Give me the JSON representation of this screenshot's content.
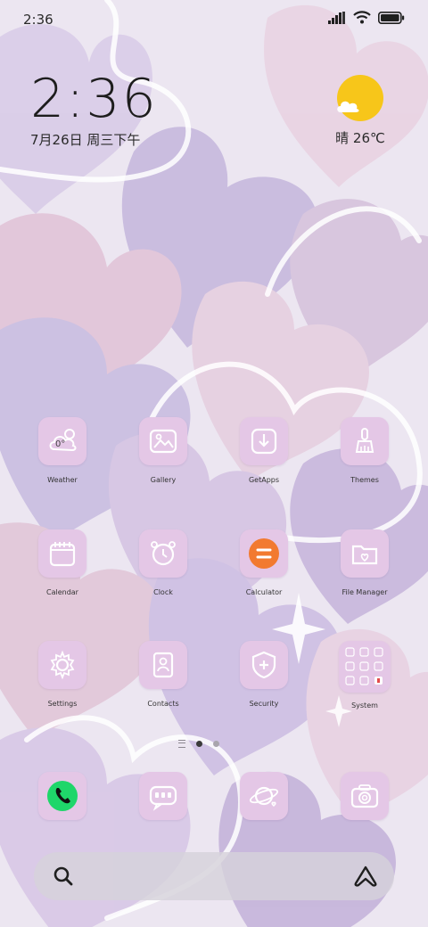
{
  "status_bar": {
    "time": "2:36",
    "icons": [
      "signal-icon",
      "wifi-icon",
      "battery-icon"
    ]
  },
  "clock_widget": {
    "time": "2:36",
    "date": "7月26日 周三下午"
  },
  "weather_widget": {
    "icon": "sun-cloud-icon",
    "text": "晴 26℃"
  },
  "apps": [
    {
      "label": "Weather",
      "icon": "weather-icon"
    },
    {
      "label": "Gallery",
      "icon": "gallery-icon"
    },
    {
      "label": "GetApps",
      "icon": "getapps-icon"
    },
    {
      "label": "Themes",
      "icon": "themes-icon"
    },
    {
      "label": "Calendar",
      "icon": "calendar-icon"
    },
    {
      "label": "Clock",
      "icon": "clock-icon"
    },
    {
      "label": "Calculator",
      "icon": "calculator-icon"
    },
    {
      "label": "File Manager",
      "icon": "file-manager-icon"
    },
    {
      "label": "Settings",
      "icon": "settings-icon"
    },
    {
      "label": "Contacts",
      "icon": "contacts-icon"
    },
    {
      "label": "Security",
      "icon": "security-icon"
    },
    {
      "label": "System",
      "icon": "system-folder-icon"
    }
  ],
  "weather_app_glyph": "0°",
  "pager": {
    "pages": 2,
    "active_page": 1
  },
  "dock": [
    "phone-icon",
    "messages-icon",
    "browser-icon",
    "camera-icon"
  ],
  "search_bar": {
    "left_icon": "search-icon",
    "right_icon": "assistant-icon"
  },
  "colors": {
    "wallpaper_base": "#ece6f1",
    "heart_lilac": "#cbbfe0",
    "heart_pink": "#e3c3d6",
    "tile": "#e4c7e6",
    "calculator_orange": "#f27a30",
    "phone_green": "#1fd66a",
    "sun_yellow": "#f7c61a"
  }
}
